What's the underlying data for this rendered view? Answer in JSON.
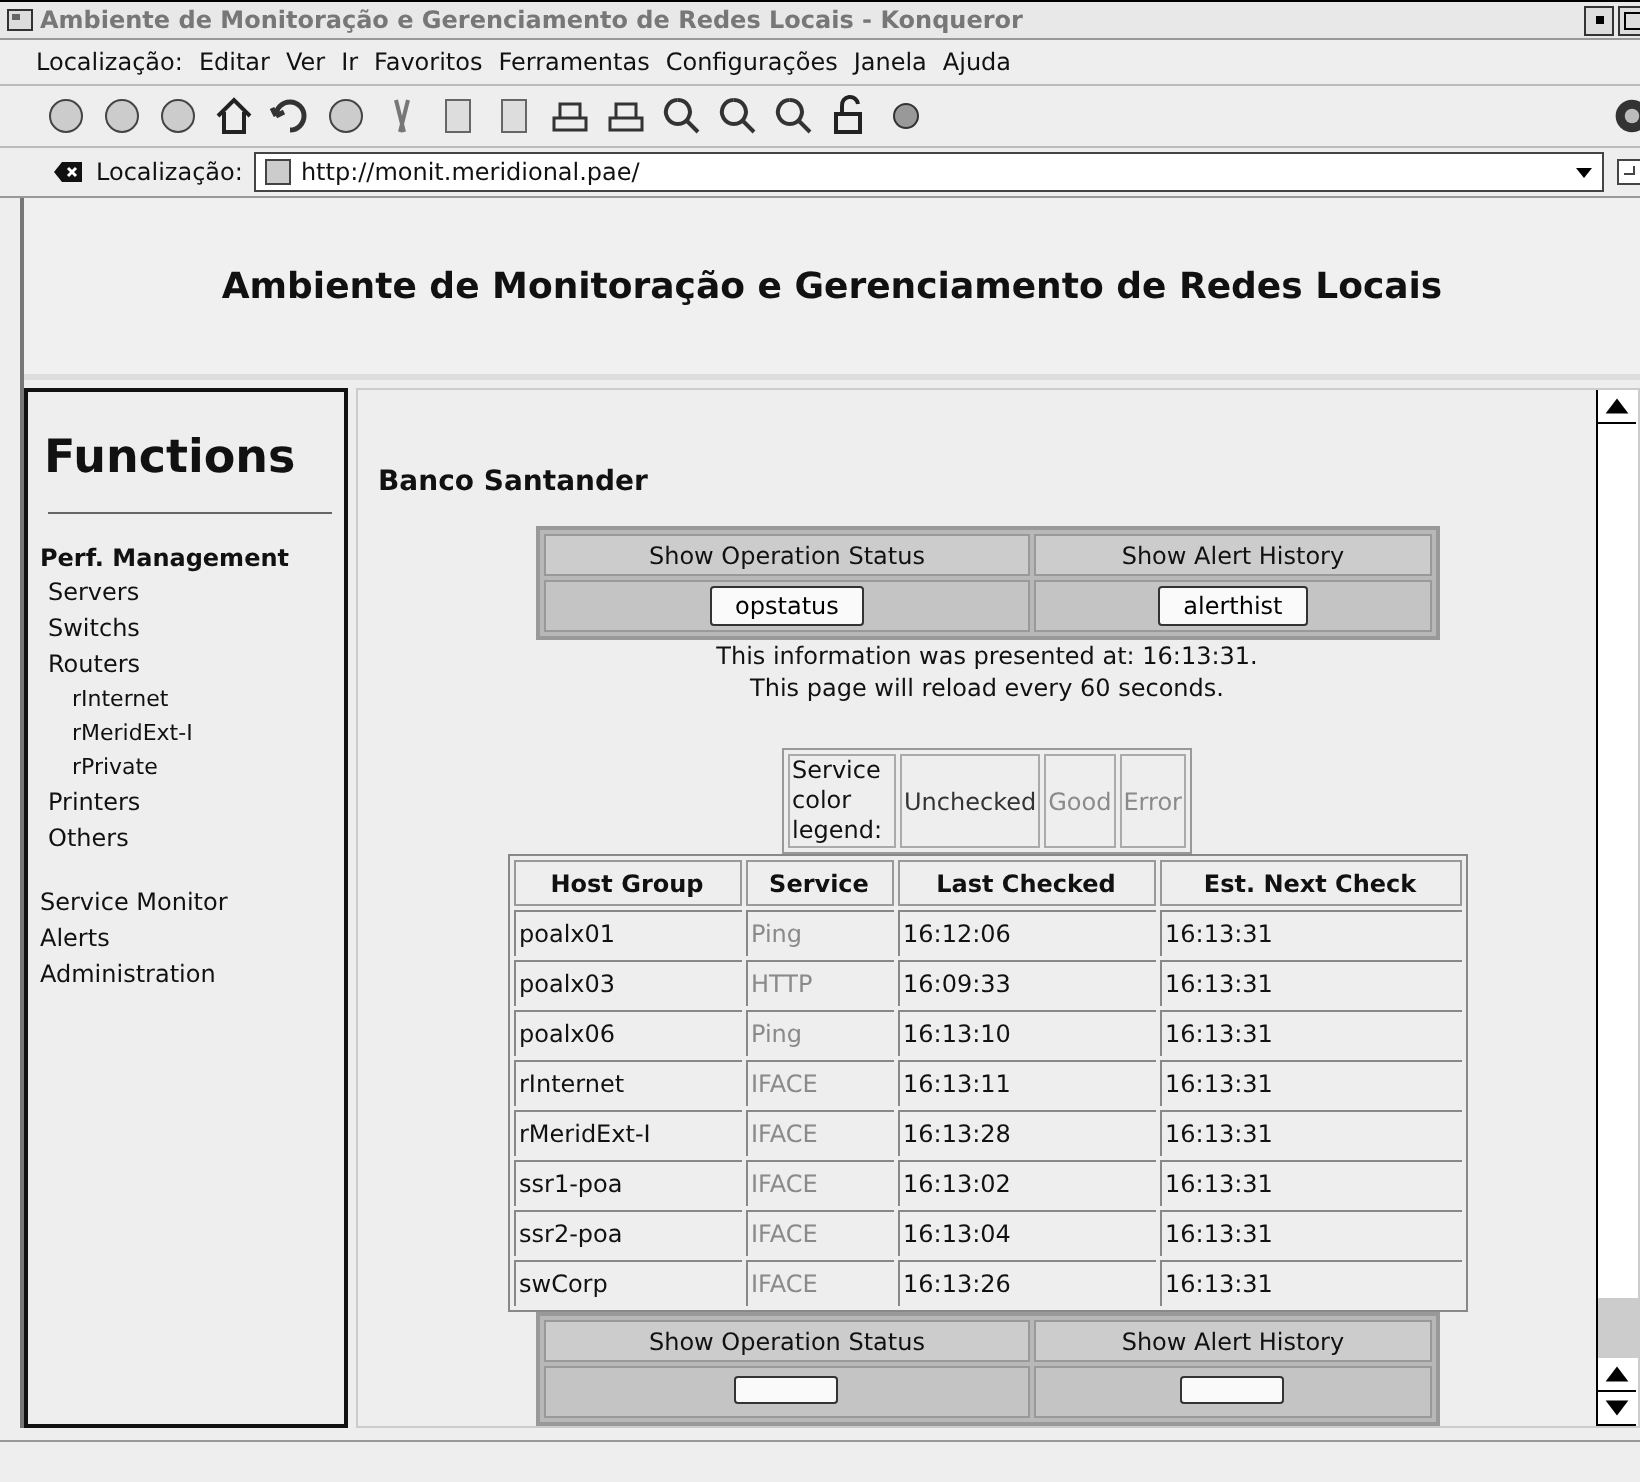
{
  "window": {
    "title": "Ambiente de Monitoração e Gerenciamento de Redes Locais - Konqueror"
  },
  "menu": [
    "Localização:",
    "Editar",
    "Ver",
    "Ir",
    "Favoritos",
    "Ferramentas",
    "Configurações",
    "Janela",
    "Ajuda"
  ],
  "location": {
    "label": "Localização:",
    "value": "http://monit.meridional.pae/"
  },
  "page": {
    "heading": "Ambiente de Monitoração e Gerenciamento de Redes Locais",
    "sidebar": {
      "title": "Functions",
      "groups": [
        {
          "label": "Perf. Management",
          "items": [
            {
              "label": "Servers"
            },
            {
              "label": "Switchs"
            },
            {
              "label": "Routers",
              "children": [
                {
                  "label": "rInternet"
                },
                {
                  "label": "rMeridExt-I"
                },
                {
                  "label": "rPrivate"
                }
              ]
            },
            {
              "label": "Printers"
            },
            {
              "label": "Others"
            }
          ]
        },
        {
          "label": "Service Monitor"
        },
        {
          "label": "Alerts"
        },
        {
          "label": "Administration"
        }
      ]
    },
    "org": "Banco Santander",
    "actions": [
      {
        "title": "Show Operation Status",
        "button": "opstatus"
      },
      {
        "title": "Show Alert History",
        "button": "alerthist"
      }
    ],
    "info": [
      "This information was presented at: 16:13:31.",
      "This page will reload every 60 seconds."
    ],
    "legend": {
      "label": "Service color legend:",
      "items": [
        {
          "label": "Unchecked",
          "color": "#333333"
        },
        {
          "label": "Good",
          "color": "#8a8a8a"
        },
        {
          "label": "Error",
          "color": "#8a8a8a"
        }
      ]
    },
    "table": {
      "columns": [
        "Host Group",
        "Service",
        "Last Checked",
        "Est. Next Check"
      ],
      "rows": [
        {
          "host": "poalx01",
          "service": "Ping",
          "color": "#8a8a8a",
          "last": "16:12:06",
          "next": "16:13:31"
        },
        {
          "host": "poalx03",
          "service": "HTTP",
          "color": "#8a8a8a",
          "last": "16:09:33",
          "next": "16:13:31"
        },
        {
          "host": "poalx06",
          "service": "Ping",
          "color": "#8a8a8a",
          "last": "16:13:10",
          "next": "16:13:31"
        },
        {
          "host": "rInternet",
          "service": "IFACE",
          "color": "#8a8a8a",
          "last": "16:13:11",
          "next": "16:13:31"
        },
        {
          "host": "rMeridExt-I",
          "service": "IFACE",
          "color": "#8a8a8a",
          "last": "16:13:28",
          "next": "16:13:31"
        },
        {
          "host": "ssr1-poa",
          "service": "IFACE",
          "color": "#8a8a8a",
          "last": "16:13:02",
          "next": "16:13:31"
        },
        {
          "host": "ssr2-poa",
          "service": "IFACE",
          "color": "#8a8a8a",
          "last": "16:13:04",
          "next": "16:13:31"
        },
        {
          "host": "swCorp",
          "service": "IFACE",
          "color": "#8a8a8a",
          "last": "16:13:26",
          "next": "16:13:31"
        }
      ]
    },
    "bottom_actions": [
      {
        "title": "Show Operation Status"
      },
      {
        "title": "Show Alert History"
      }
    ]
  }
}
